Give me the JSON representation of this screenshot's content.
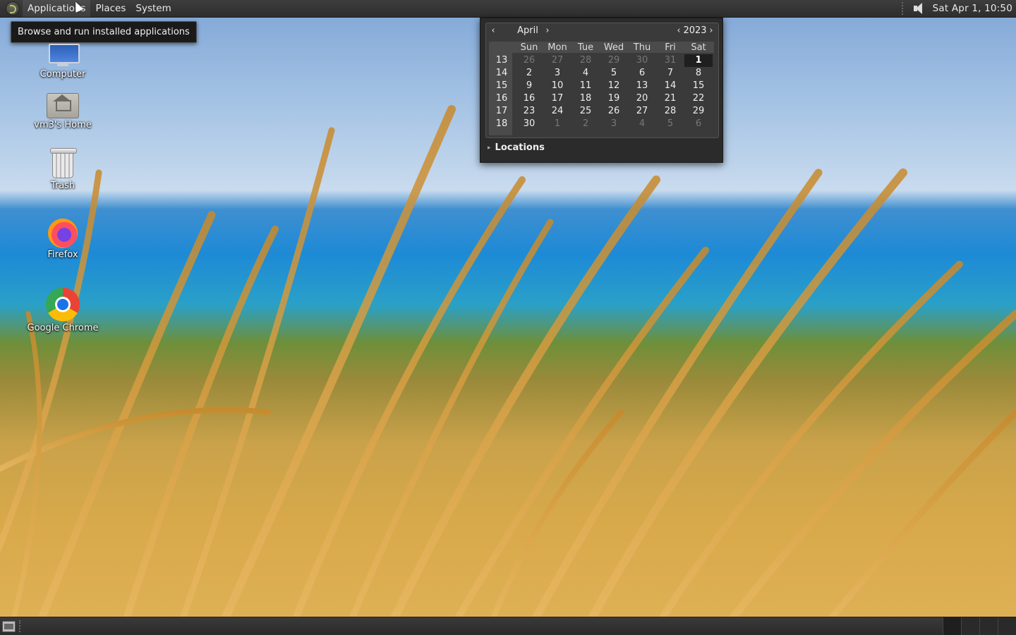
{
  "top_panel": {
    "menus": [
      "Applications",
      "Places",
      "System"
    ],
    "clock": "Sat Apr  1, 10:50"
  },
  "tooltip": "Browse and run installed applications",
  "desktop_icons": [
    "Computer",
    "vm3's Home",
    "Trash",
    "Firefox",
    "Google Chrome"
  ],
  "calendar": {
    "month": "April",
    "year": "2023",
    "prev_month": "‹",
    "next_month": "›",
    "prev_year": "‹",
    "next_year": "›",
    "day_headers": [
      "Sun",
      "Mon",
      "Tue",
      "Wed",
      "Thu",
      "Fri",
      "Sat"
    ],
    "weeks": [
      {
        "week": "13",
        "days": [
          "26",
          "27",
          "28",
          "29",
          "30",
          "31",
          "1"
        ]
      },
      {
        "week": "14",
        "days": [
          "2",
          "3",
          "4",
          "5",
          "6",
          "7",
          "8"
        ]
      },
      {
        "week": "15",
        "days": [
          "9",
          "10",
          "11",
          "12",
          "13",
          "14",
          "15"
        ]
      },
      {
        "week": "16",
        "days": [
          "16",
          "17",
          "18",
          "19",
          "20",
          "21",
          "22"
        ]
      },
      {
        "week": "17",
        "days": [
          "23",
          "24",
          "25",
          "26",
          "27",
          "28",
          "29"
        ]
      },
      {
        "week": "18",
        "days": [
          "30",
          "1",
          "2",
          "3",
          "4",
          "5",
          "6"
        ]
      }
    ],
    "locations_label": "Locations"
  },
  "colors": {
    "panel_bg": "#2e2e2e",
    "popup_bg": "#2b2b2b",
    "today_bg": "#1f1f1f",
    "dim_text": "#777777"
  },
  "icons": {
    "menu_logo": "applications-logo-icon",
    "volume": "volume-icon",
    "show_desktop": "show-desktop-icon"
  }
}
